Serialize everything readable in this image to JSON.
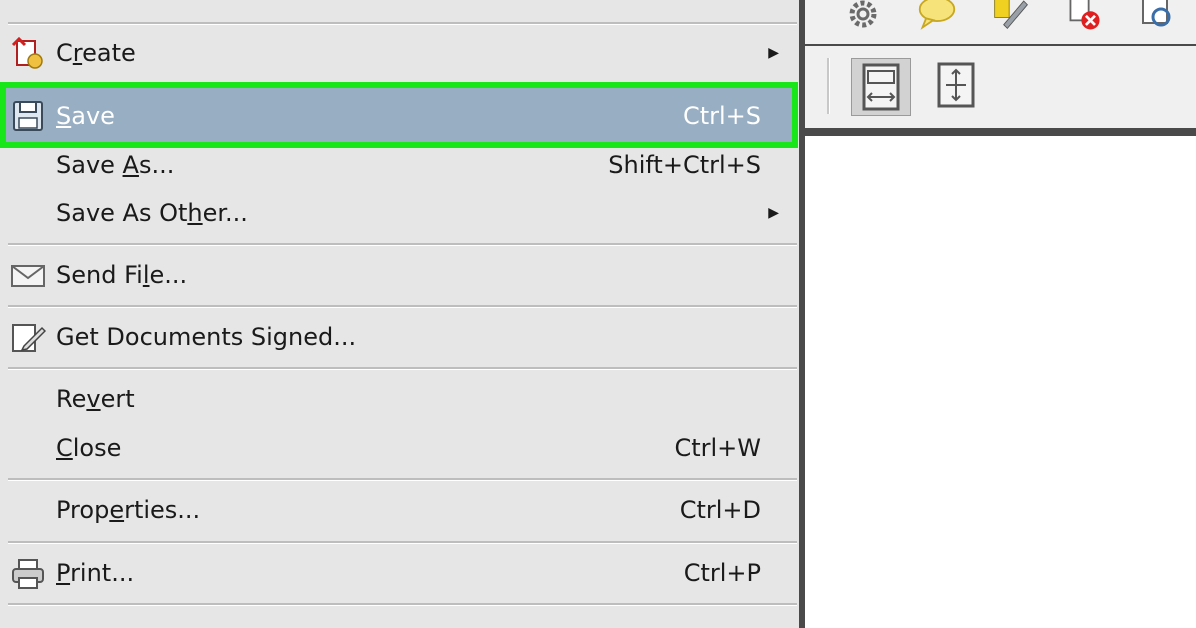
{
  "menu": {
    "items": [
      {
        "id": "create",
        "label": "Create",
        "underline_index": 1,
        "shortcut": "",
        "submenu": true,
        "icon": "create-pdf-icon"
      },
      {
        "id": "save",
        "label": "Save",
        "underline_index": 0,
        "shortcut": "Ctrl+S",
        "submenu": false,
        "icon": "save-disk-icon",
        "highlighted": true
      },
      {
        "id": "save-as",
        "label": "Save As...",
        "underline_index": 5,
        "shortcut": "Shift+Ctrl+S",
        "submenu": false,
        "icon": ""
      },
      {
        "id": "save-as-other",
        "label": "Save As Other...",
        "underline_index": 10,
        "shortcut": "",
        "submenu": true,
        "icon": ""
      },
      {
        "id": "send-file",
        "label": "Send File...",
        "underline_index": 7,
        "shortcut": "",
        "submenu": false,
        "icon": "envelope-icon"
      },
      {
        "id": "get-documents-signed",
        "label": "Get Documents Signed...",
        "underline_index": -1,
        "shortcut": "",
        "submenu": false,
        "icon": "sign-document-icon"
      },
      {
        "id": "revert",
        "label": "Revert",
        "underline_index": 2,
        "shortcut": "",
        "submenu": false,
        "icon": ""
      },
      {
        "id": "close",
        "label": "Close",
        "underline_index": 0,
        "shortcut": "Ctrl+W",
        "submenu": false,
        "icon": ""
      },
      {
        "id": "properties",
        "label": "Properties...",
        "underline_index": 4,
        "shortcut": "Ctrl+D",
        "submenu": false,
        "icon": ""
      },
      {
        "id": "print",
        "label": "Print...",
        "underline_index": 0,
        "shortcut": "Ctrl+P",
        "submenu": false,
        "icon": "printer-icon"
      }
    ]
  },
  "toolbar": {
    "top_icons": [
      "gear-icon",
      "comment-icon",
      "sign-pen-icon",
      "remove-file-icon",
      "find-icon"
    ],
    "second_icons": [
      "fit-page-icon",
      "full-screen-icon"
    ]
  },
  "colors": {
    "highlight_border": "#19e619",
    "selected_bg": "#97aec3",
    "menu_bg": "#e6e6e6"
  }
}
